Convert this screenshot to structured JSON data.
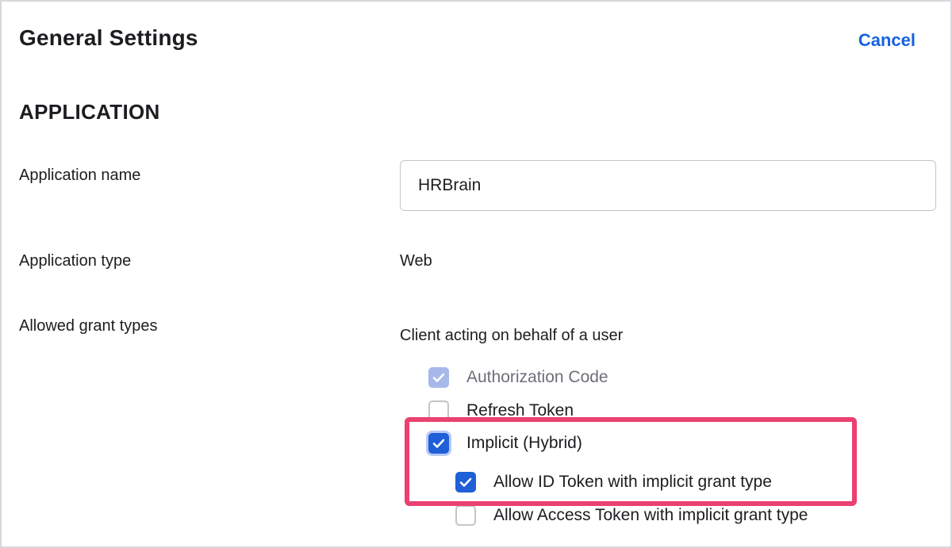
{
  "header": {
    "title": "General Settings",
    "cancel_label": "Cancel"
  },
  "section": {
    "title": "APPLICATION"
  },
  "fields": {
    "app_name_label": "Application name",
    "app_name_value": "HRBrain",
    "app_type_label": "Application type",
    "app_type_value": "Web",
    "grant_types_label": "Allowed grant types"
  },
  "grant_types": {
    "group_heading": "Client acting on behalf of a user",
    "items": [
      {
        "label": "Authorization Code",
        "checked": true,
        "disabled": true
      },
      {
        "label": "Refresh Token",
        "checked": false,
        "disabled": false
      },
      {
        "label": "Implicit (Hybrid)",
        "checked": true,
        "disabled": false
      },
      {
        "label": "Allow ID Token with implicit grant type",
        "checked": true,
        "disabled": false
      },
      {
        "label": "Allow Access Token with implicit grant type",
        "checked": false,
        "disabled": false
      }
    ]
  },
  "colors": {
    "accent": "#1f5fd8",
    "link": "#1662dd",
    "highlight": "#eb4170",
    "disabled_check": "#a7b9ea"
  },
  "icons": {
    "check": "checkmark-icon"
  }
}
